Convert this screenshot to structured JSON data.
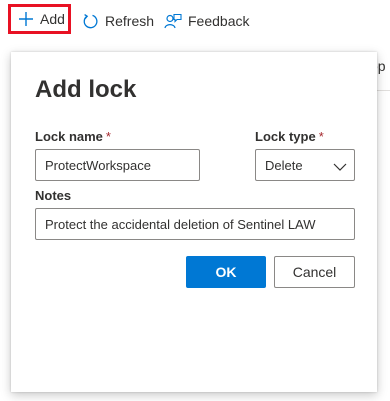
{
  "toolbar": {
    "add_label": "Add",
    "refresh_label": "Refresh",
    "feedback_label": "Feedback"
  },
  "background": {
    "column_header_fragment": "op"
  },
  "dialog": {
    "title": "Add lock",
    "lock_name_label": "Lock name",
    "lock_name_required": "*",
    "lock_name_value": "ProtectWorkspace",
    "lock_type_label": "Lock type",
    "lock_type_required": "*",
    "lock_type_value": "Delete",
    "notes_label": "Notes",
    "notes_value": "Protect the accidental deletion of Sentinel LAW",
    "ok_label": "OK",
    "cancel_label": "Cancel"
  },
  "colors": {
    "accent": "#0078d4",
    "highlight_border": "#e81123",
    "required": "#a4262c"
  },
  "icons": {
    "add": "plus-icon",
    "refresh": "refresh-icon",
    "feedback": "feedback-icon",
    "dropdown": "chevron-down-icon"
  }
}
